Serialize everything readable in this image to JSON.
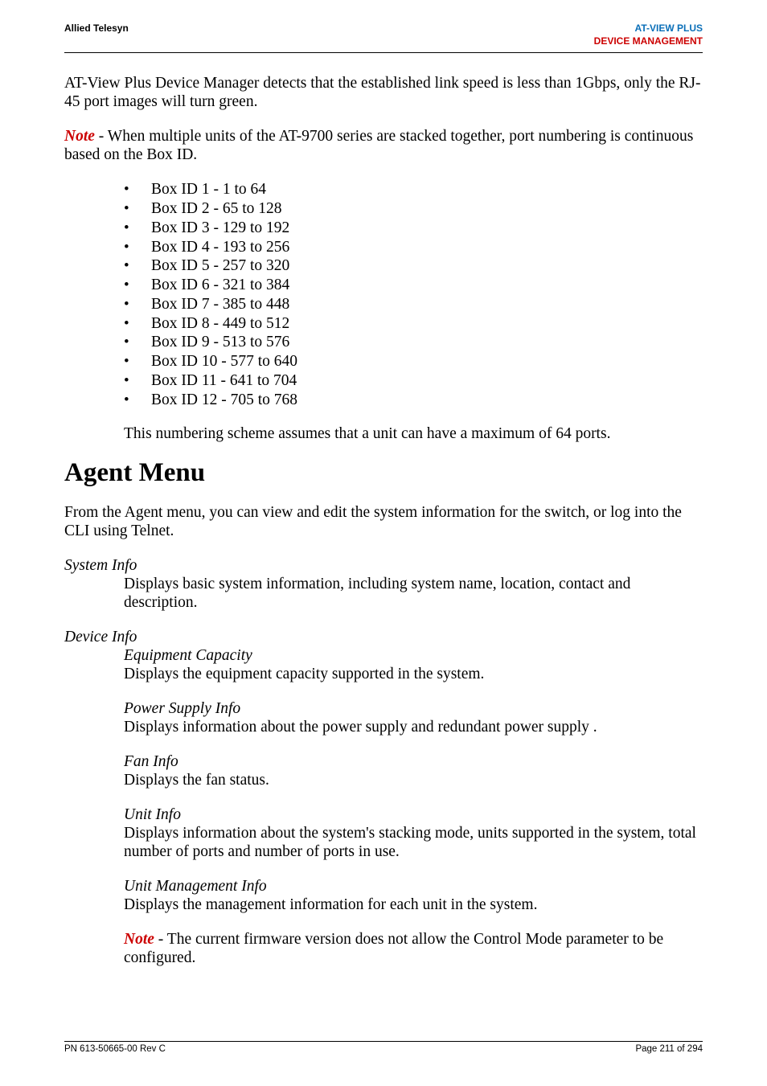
{
  "header": {
    "left": "Allied Telesyn",
    "brand": "AT-VIEW PLUS",
    "section": "DEVICE MANAGEMENT"
  },
  "para1": "AT-View Plus Device Manager detects that the established link speed is less than 1Gbps, only the RJ-45 port images will turn green.",
  "note1_label": "Note",
  "note1_text": " - When multiple units of the AT-9700 series are stacked together, port numbering is continuous based on the Box ID.",
  "bullets": [
    "Box ID 1 - 1 to 64",
    "Box ID 2 - 65 to 128",
    "Box ID 3 - 129 to 192",
    "Box ID 4 - 193 to 256",
    "Box ID 5 - 257 to 320",
    "Box ID 6 - 321 to 384",
    "Box ID 7 - 385 to 448",
    "Box ID 8 - 449 to 512",
    "Box ID 9 - 513 to 576",
    "Box ID 10 - 577 to 640",
    "Box ID 11 - 641 to 704",
    "Box ID 12 - 705 to 768"
  ],
  "numbering_note": "This numbering scheme assumes that a unit can have a maximum of 64 ports.",
  "agent_heading": "Agent Menu",
  "agent_intro": "From the Agent menu, you can view and edit the system information for the switch, or log into the CLI using Telnet.",
  "system_info": {
    "title": "System Info",
    "desc": "Displays basic system information, including system name, location, contact and description."
  },
  "device_info": {
    "title": "Device Info",
    "equipment": {
      "title": "Equipment Capacity",
      "desc": "Displays the equipment capacity supported in the system."
    },
    "power": {
      "title": "Power Supply Info",
      "desc": "Displays information about the power supply and redundant power supply ."
    },
    "fan": {
      "title": "Fan Info",
      "desc": "Displays the fan status."
    },
    "unit": {
      "title": "Unit Info",
      "desc": "Displays information about the system's stacking mode, units supported in the system, total number of ports and number of ports in use."
    },
    "mgmt": {
      "title": "Unit Management Info",
      "desc": "Displays the management information for each unit in the system."
    },
    "note2_label": "Note",
    "note2_text": " - The current firmware version does not allow the Control Mode parameter to be configured."
  },
  "footer": {
    "left": "PN 613-50665-00 Rev C",
    "right": "Page 211 of 294"
  }
}
